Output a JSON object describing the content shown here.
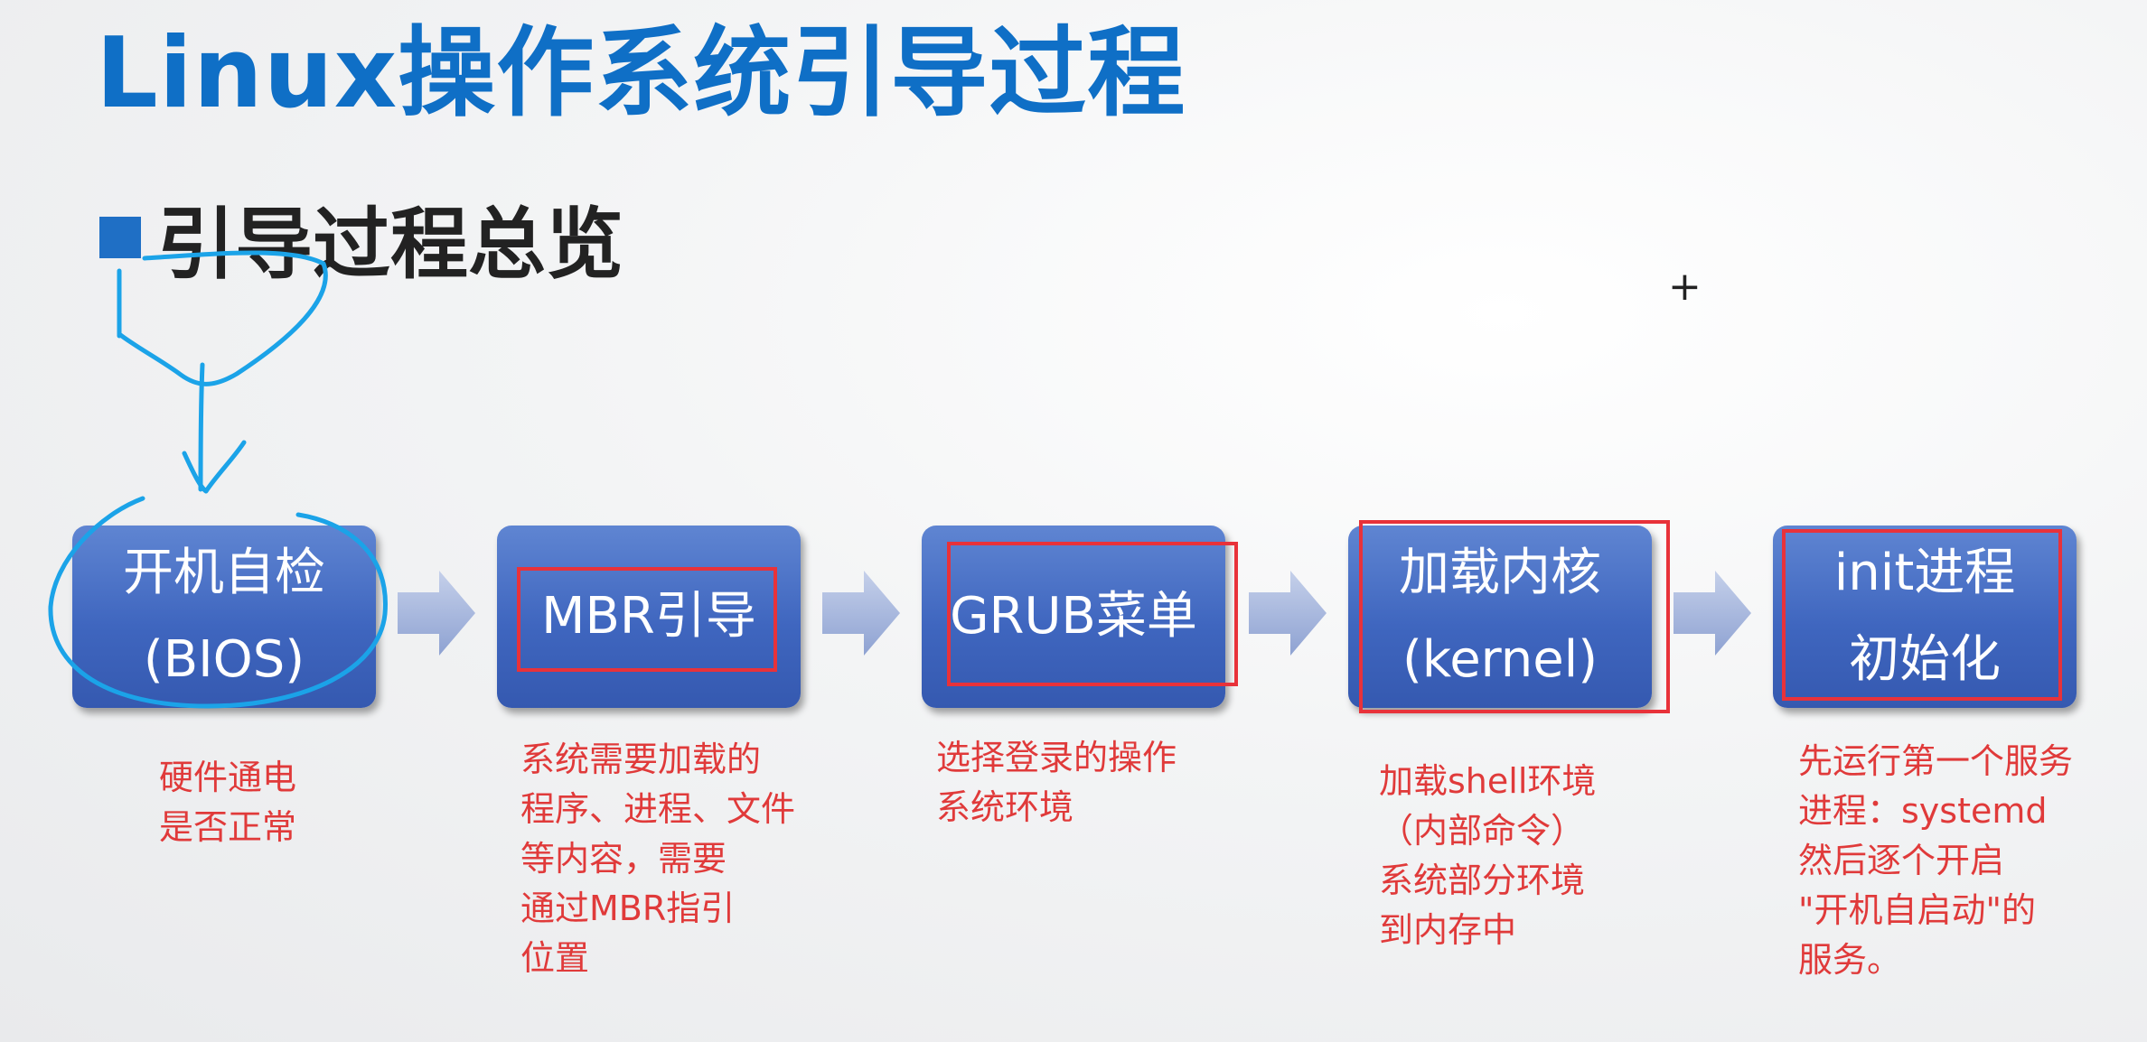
{
  "title": "Linux操作系统引导过程",
  "subtitle": "引导过程总览",
  "steps": [
    {
      "line1": "开机自检",
      "line2": "(BIOS)"
    },
    {
      "line1": "MBR引导",
      "line2": ""
    },
    {
      "line1": "GRUB菜单",
      "line2": ""
    },
    {
      "line1": "加载内核",
      "line2": "(kernel)"
    },
    {
      "line1": "init进程",
      "line2": "初始化"
    }
  ],
  "notes": [
    [
      "硬件通电",
      "是否正常"
    ],
    [
      "系统需要加载的",
      "程序、进程、文件",
      "等内容，需要",
      "通过MBR指引",
      "位置"
    ],
    [
      "选择登录的操作",
      "系统环境"
    ],
    [
      "加载shell环境",
      "（内部命令）",
      "系统部分环境",
      "到内存中"
    ],
    [
      "先运行第一个服务",
      "进程：systemd",
      "然后逐个开启",
      "\"开机自启动\"的",
      "服务。"
    ]
  ],
  "colors": {
    "title": "#0f6fc6",
    "box": "#4a6fc6",
    "note": "#e03a3a",
    "annotation_red": "#e8323a",
    "annotation_blue": "#1ba3e8"
  }
}
